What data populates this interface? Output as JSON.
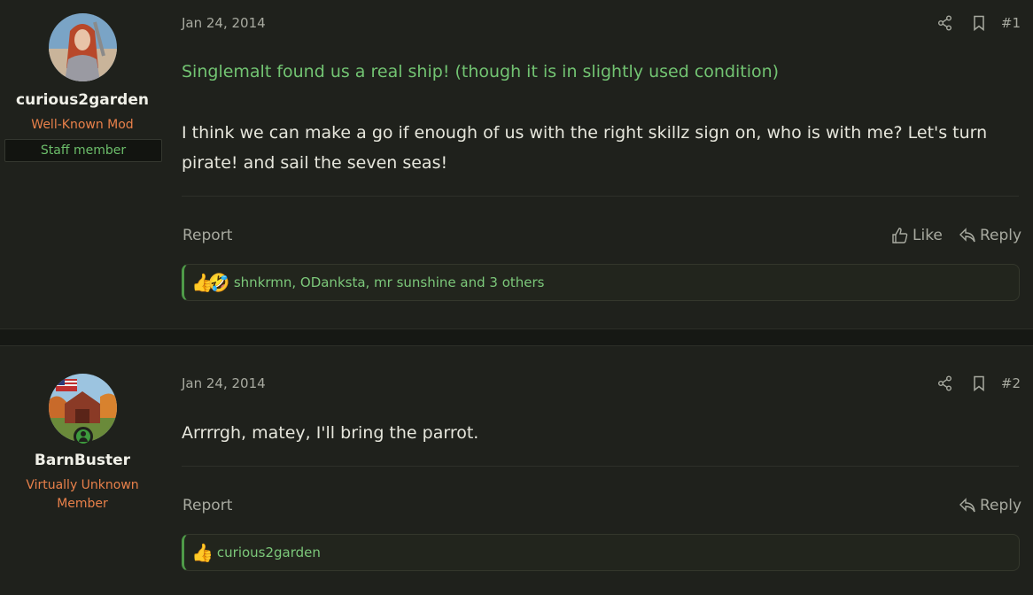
{
  "posts": [
    {
      "number": "#1",
      "date": "Jan 24, 2014",
      "author": {
        "name": "curious2garden",
        "title": "Well-Known Mod",
        "badge": "Staff member",
        "online": false
      },
      "content": {
        "highlight": "Singlemalt found us a real ship! (though it is in slightly used condition)",
        "body": "I think we can make a go if enough of us with the right skillz sign on, who is with me? Let's turn pirate! and sail the seven seas!"
      },
      "actions": {
        "report": "Report",
        "like": "Like",
        "reply": "Reply"
      },
      "reactions": {
        "emojis": [
          "👍",
          "🤣"
        ],
        "text": "shnkrmn, ODanksta, mr sunshine and 3 others"
      }
    },
    {
      "number": "#2",
      "date": "Jan 24, 2014",
      "author": {
        "name": "BarnBuster",
        "title_line1": "Virtually Unknown",
        "title_line2": "Member",
        "online": true
      },
      "content": {
        "body": "Arrrrgh, matey, I'll bring the parrot."
      },
      "actions": {
        "report": "Report",
        "reply": "Reply"
      },
      "reactions": {
        "emojis": [
          "👍"
        ],
        "text": "curious2garden"
      }
    }
  ],
  "colors": {
    "background": "#1f211c",
    "accent_green": "#72c472",
    "title_orange": "#e8804a"
  },
  "icons": [
    "share-icon",
    "bookmark-icon",
    "thumbs-up-icon",
    "reply-icon",
    "online-user-icon"
  ]
}
